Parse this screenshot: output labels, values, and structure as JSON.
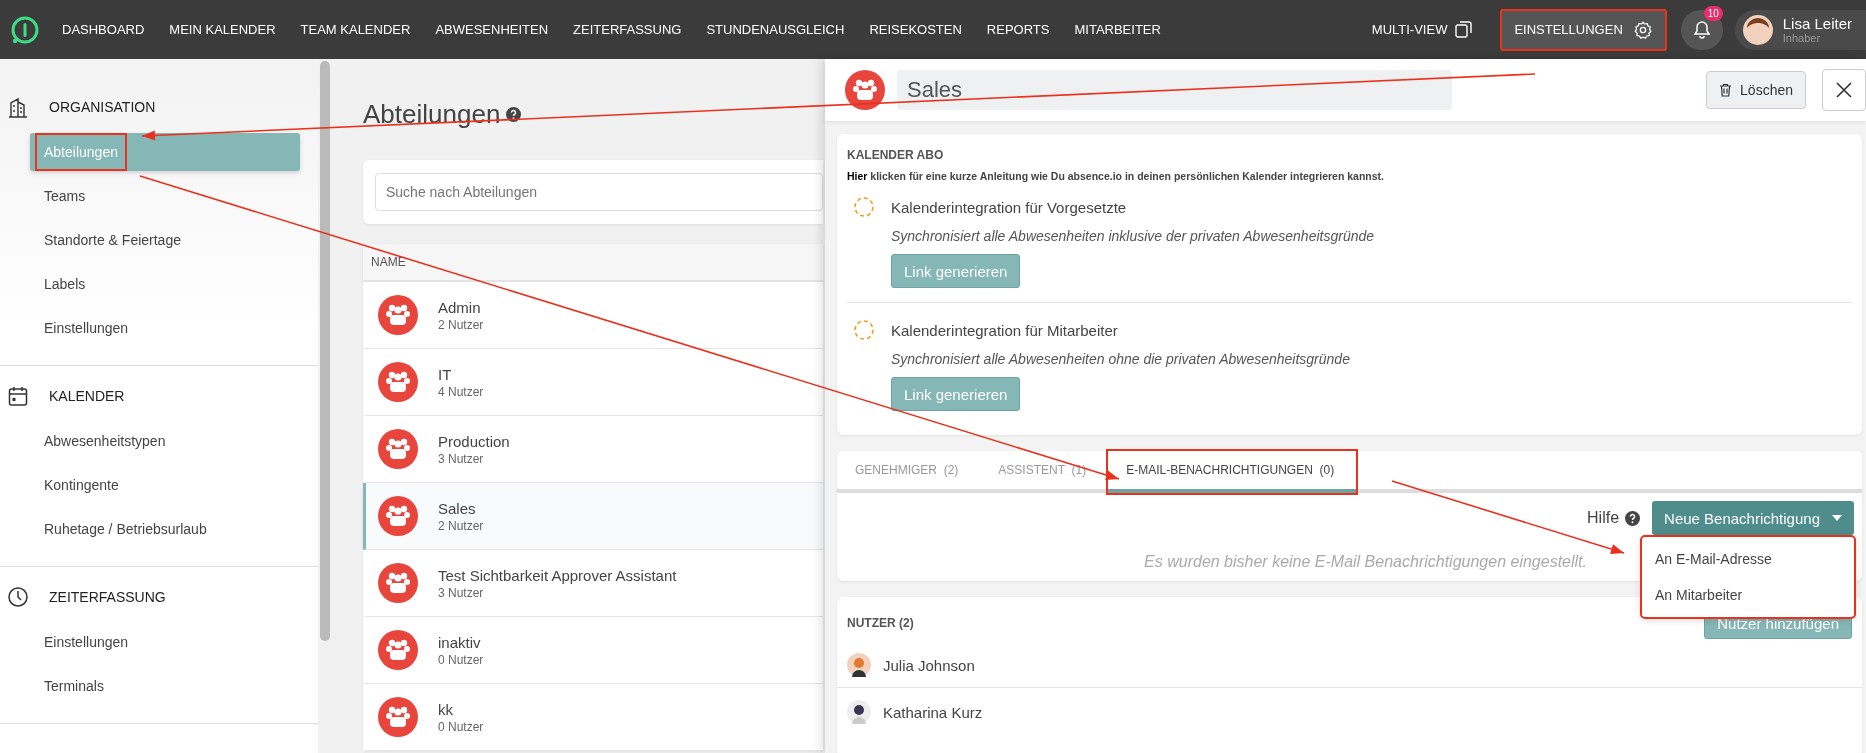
{
  "top_bar": {
    "nav": [
      {
        "label": "DASHBOARD"
      },
      {
        "label": "MEIN KALENDER"
      },
      {
        "label": "TEAM KALENDER"
      },
      {
        "label": "ABWESENHEITEN"
      },
      {
        "label": "ZEITERFASSUNG"
      },
      {
        "label": "STUNDENAUSGLEICH"
      },
      {
        "label": "REISEKOSTEN"
      },
      {
        "label": "REPORTS"
      },
      {
        "label": "MITARBEITER"
      }
    ],
    "multi_view": "MULTI-VIEW",
    "settings": {
      "label": "EINSTELLUNGEN",
      "annotated": true
    },
    "notifications": {
      "count": "10"
    },
    "user": {
      "name": "Lisa Leiter",
      "role": "Inhaber"
    }
  },
  "sidebar": {
    "sections": [
      {
        "kind": "building",
        "title": "ORGANISATION",
        "items": [
          {
            "label": "Abteilungen",
            "selected": true,
            "annotated": true
          },
          {
            "label": "Teams",
            "selected": false,
            "annotated": false
          },
          {
            "label": "Standorte & Feiertage",
            "selected": false,
            "annotated": false
          },
          {
            "label": "Labels",
            "selected": false,
            "annotated": false
          },
          {
            "label": "Einstellungen",
            "selected": false,
            "annotated": false
          }
        ]
      },
      {
        "kind": "calendar",
        "title": "KALENDER",
        "items": [
          {
            "label": "Abwesenheitstypen",
            "selected": false,
            "annotated": false
          },
          {
            "label": "Kontingente",
            "selected": false,
            "annotated": false
          },
          {
            "label": "Ruhetage / Betriebsurlaub",
            "selected": false,
            "annotated": false
          }
        ]
      },
      {
        "kind": "clock",
        "title": "ZEITERFASSUNG",
        "items": [
          {
            "label": "Einstellungen",
            "selected": false,
            "annotated": false
          },
          {
            "label": "Terminals",
            "selected": false,
            "annotated": false
          }
        ]
      }
    ]
  },
  "page": {
    "title": "Abteilungen",
    "search": {
      "placeholder": "Suche nach Abteilungen"
    },
    "column": "NAME",
    "rows": [
      {
        "name": "Admin",
        "count": "2 Nutzer",
        "selected": false
      },
      {
        "name": "IT",
        "count": "4 Nutzer",
        "selected": false
      },
      {
        "name": "Production",
        "count": "3 Nutzer",
        "selected": false
      },
      {
        "name": "Sales",
        "count": "2 Nutzer",
        "selected": true
      },
      {
        "name": "Test Sichtbarkeit Approver Assistant",
        "count": "3 Nutzer",
        "selected": false
      },
      {
        "name": "inaktiv",
        "count": "0 Nutzer",
        "selected": false
      },
      {
        "name": "kk",
        "count": "0 Nutzer",
        "selected": false
      }
    ]
  },
  "detail": {
    "name": "Sales",
    "delete": "Löschen",
    "calendar": {
      "title": "KALENDER ABO",
      "hint": "**Hier** klicken für eine kurze Anleitung wie Du absence.io in deinen persönlichen Kalender integrieren kannst.",
      "integrations": [
        {
          "title": "Kalenderintegration für Vorgesetzte",
          "description": "Synchronisiert alle Abwesenheiten inklusive der privaten Abwesenheitsgründe",
          "button": "Link generieren"
        },
        {
          "title": "Kalenderintegration für Mitarbeiter",
          "description": "Synchronisiert alle Abwesenheiten ohne die privaten Abwesenheitsgründe",
          "button": "Link generieren"
        }
      ]
    },
    "tabs": [
      {
        "label": "GENEHMIGER  (2)",
        "selected": false,
        "annotated": false
      },
      {
        "label": "ASSISTENT  (1)",
        "selected": false,
        "annotated": false
      },
      {
        "label": "E-MAIL-BENACHRICHTIGUNGEN  (0)",
        "selected": true,
        "annotated": true
      }
    ],
    "help": "Hilfe",
    "new_button": {
      "label": "Neue Benachrichtigung",
      "expanded": true
    },
    "menu": {
      "annotated": true,
      "items": [
        {
          "label": "An E-Mail-Adresse"
        },
        {
          "label": "An Mitarbeiter"
        }
      ]
    },
    "empty": "Es wurden bisher keine E-Mail Benachrichtigungen eingestellt.",
    "users": {
      "title": "NUTZER (2)",
      "add": "Nutzer hinzufügen",
      "list": [
        {
          "name": "Julia Johnson"
        },
        {
          "name": "Katharina Kurz"
        }
      ]
    }
  }
}
